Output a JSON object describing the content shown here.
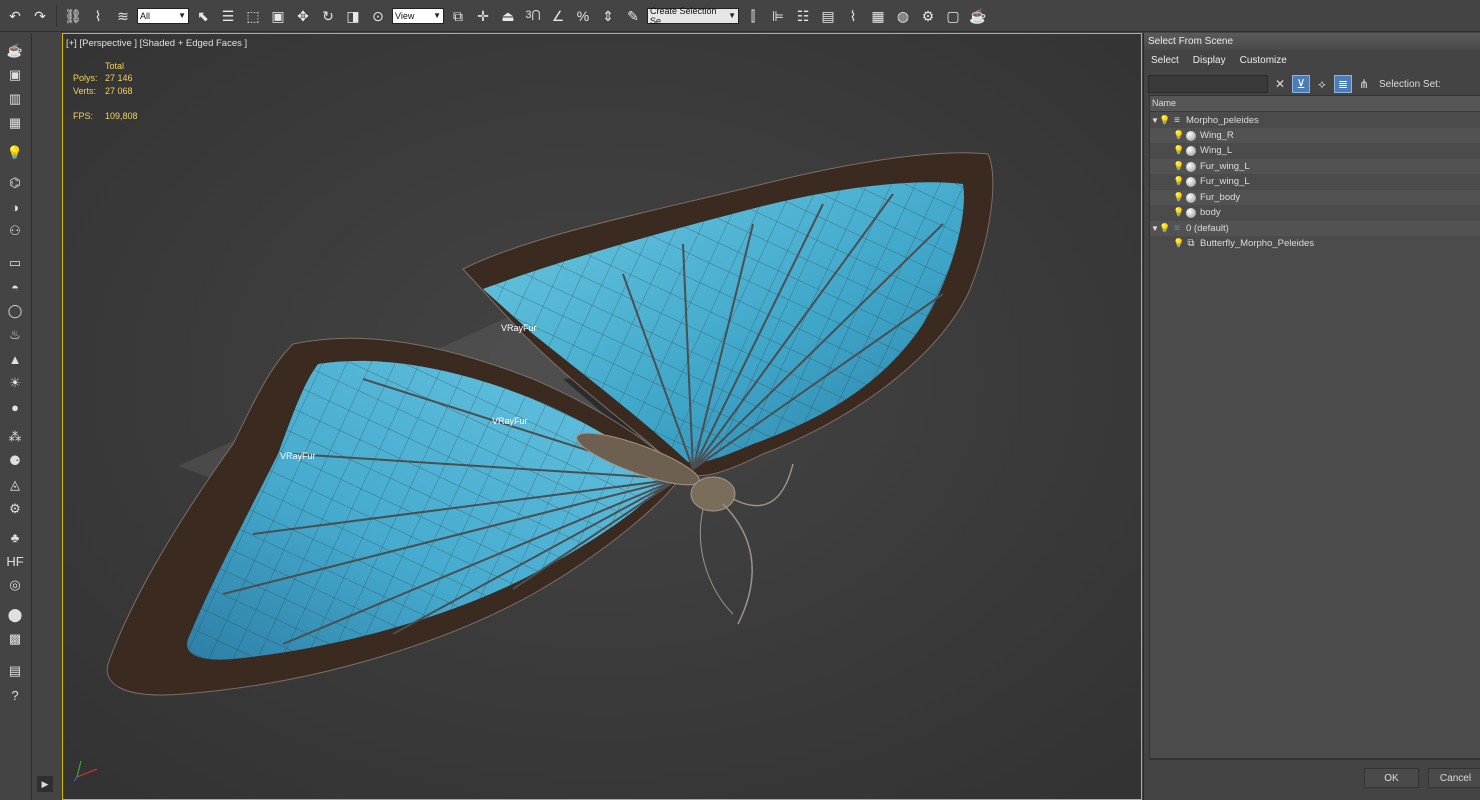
{
  "toolbar": {
    "selection_filter": "All",
    "reference_coord": "View",
    "selection_set_placeholder": "Create Selection Se"
  },
  "viewport": {
    "label": "[+] [Perspective ] [Shaded + Edged Faces ]",
    "stats": {
      "total_label": "Total",
      "polys_label": "Polys:",
      "polys_value": "27 146",
      "verts_label": "Verts:",
      "verts_value": "27 068",
      "fps_label": "FPS:",
      "fps_value": "109,808"
    },
    "annotations": [
      "VRayFur",
      "VRayFur",
      "VRayFur"
    ],
    "colors": {
      "wing_blue": "#4fb3d4",
      "wing_dark": "#3a2a20",
      "grid": "#6a6a6a",
      "frame": "#d4b500"
    }
  },
  "scene_explorer": {
    "title": "Select From Scene",
    "menu": [
      "Select",
      "Display",
      "Customize"
    ],
    "search_value": "",
    "selection_set_label": "Selection Set:",
    "column_header": "Name",
    "rows": [
      {
        "label": "Morpho_peleides",
        "level": 0,
        "type": "layer",
        "expanded": true
      },
      {
        "label": "Wing_R",
        "level": 1,
        "type": "object"
      },
      {
        "label": "Wing_L",
        "level": 1,
        "type": "object"
      },
      {
        "label": "Fur_wing_L",
        "level": 1,
        "type": "object"
      },
      {
        "label": "Fur_wing_L",
        "level": 1,
        "type": "object"
      },
      {
        "label": "Fur_body",
        "level": 1,
        "type": "object"
      },
      {
        "label": "body",
        "level": 1,
        "type": "object"
      },
      {
        "label": "0 (default)",
        "level": 0,
        "type": "layer-default",
        "expanded": true
      },
      {
        "label": "Butterfly_Morpho_Peleides",
        "level": 1,
        "type": "group"
      }
    ],
    "ok_label": "OK",
    "cancel_label": "Cancel"
  }
}
